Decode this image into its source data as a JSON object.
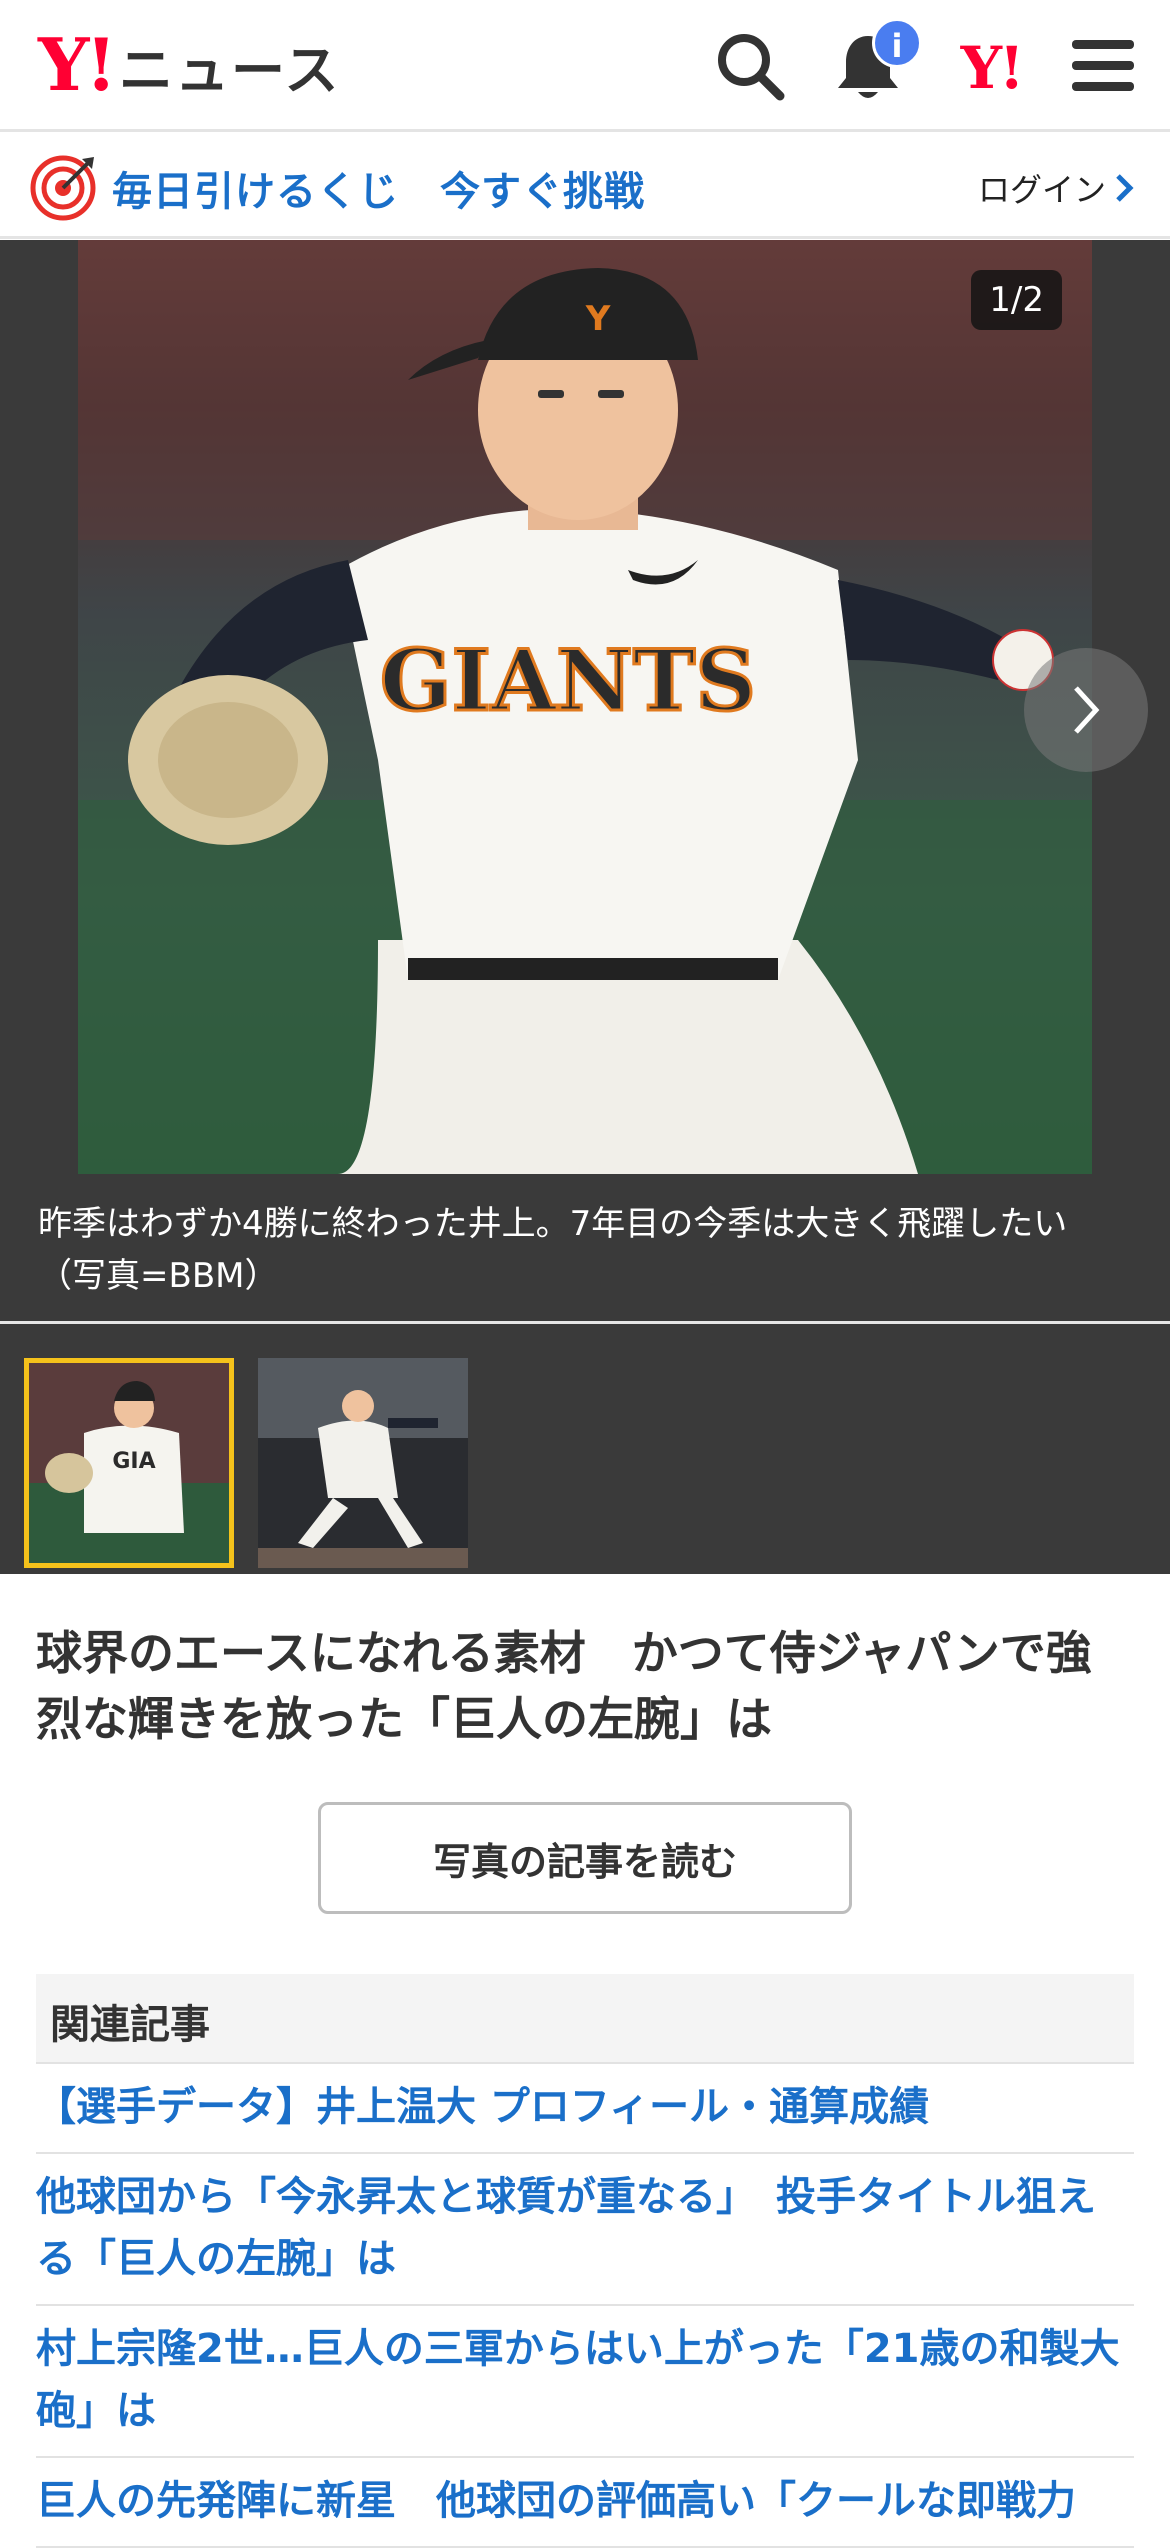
{
  "header": {
    "logo_mark": "Y!",
    "logo_text": "ニュース",
    "notification_badge": "i",
    "yahoo_mark": "Y!"
  },
  "promo": {
    "text": "毎日引けるくじ　今すぐ挑戦",
    "login_label": "ログイン"
  },
  "gallery": {
    "counter": "1/2",
    "caption": "昨季はわずか4勝に終わった井上。7年目の今季は大きく飛躍したい（写真=BBM）",
    "jersey_text": "GIANTS",
    "thumbnails": [
      {
        "selected": true
      },
      {
        "selected": false
      }
    ]
  },
  "article": {
    "headline": "球界のエースになれる素材　かつて侍ジャパンで強烈な輝きを放った「巨人の左腕」は",
    "read_button": "写真の記事を読む"
  },
  "related": {
    "heading": "関連記事",
    "items": [
      "【選手データ】井上温大 プロフィール・通算成績",
      "他球団から「今永昇太と球質が重なる」　投手タイトル狙える「巨人の左腕」は",
      "村上宗隆2世…巨人の三軍からはい上がった「21歳の和製大砲」は",
      "巨人の先発陣に新星　他球団の評価高い「クールな即戦力"
    ]
  },
  "colors": {
    "brand_red": "#ff0033",
    "link_blue": "#1a6fc9",
    "thumb_selected": "#f5c21b"
  }
}
